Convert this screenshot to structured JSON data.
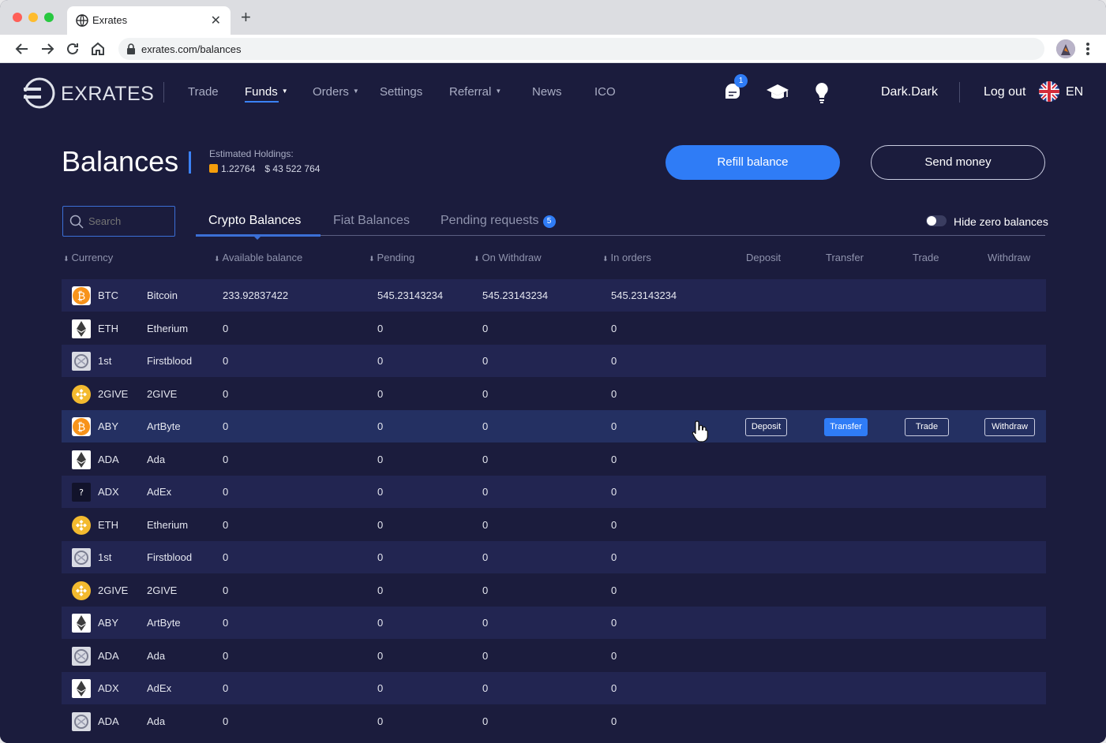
{
  "browser": {
    "tab_title": "Exrates",
    "url": "exrates.com/balances"
  },
  "header": {
    "brand": "EXRATES",
    "menu": [
      {
        "label": "Trade",
        "active": false,
        "dropdown": false
      },
      {
        "label": "Funds",
        "active": true,
        "dropdown": true
      },
      {
        "label": "Orders",
        "active": false,
        "dropdown": true
      },
      {
        "label": "Settings",
        "active": false,
        "dropdown": false
      },
      {
        "label": "Referral",
        "active": false,
        "dropdown": true
      },
      {
        "label": "News",
        "active": false,
        "dropdown": false
      },
      {
        "label": "ICO",
        "active": false,
        "dropdown": false
      }
    ],
    "notification_count": "1",
    "icons": [
      "chat-bell-icon",
      "graduation-cap-icon",
      "lightbulb-icon"
    ],
    "username": "Dark.Dark",
    "logout": "Log out",
    "language": "EN"
  },
  "page": {
    "title": "Balances",
    "estimated_label": "Estimated Holdings:",
    "estimated_btc": "1.22764",
    "estimated_usd": "$ 43 522 764",
    "refill_button": "Refill balance",
    "send_button": "Send money"
  },
  "filters": {
    "search_placeholder": "Search",
    "tabs": [
      {
        "label": "Crypto Balances",
        "active": true
      },
      {
        "label": "Fiat Balances",
        "active": false
      },
      {
        "label": "Pending requests",
        "active": false,
        "count": "5"
      }
    ],
    "hide_zero_label": "Hide zero balances",
    "hide_zero_on": false
  },
  "table": {
    "headers": {
      "currency": "Currency",
      "available": "Available balance",
      "pending": "Pending",
      "on_withdraw": "On Withdraw",
      "in_orders": "In orders",
      "deposit": "Deposit",
      "transfer": "Transfer",
      "trade": "Trade",
      "withdraw": "Withdraw"
    },
    "row_actions": {
      "deposit": "Deposit",
      "transfer": "Transfer",
      "trade": "Trade",
      "withdraw": "Withdraw"
    },
    "rows": [
      {
        "icon": "bitcoin-icon",
        "code": "BTC",
        "name": "Bitcoin",
        "available": "233.92837422",
        "pending": "545.23143234",
        "on_withdraw": "545.23143234",
        "in_orders": "545.23143234"
      },
      {
        "icon": "ethereum-icon",
        "code": "ETH",
        "name": "Etherium",
        "available": "0",
        "pending": "0",
        "on_withdraw": "0",
        "in_orders": "0"
      },
      {
        "icon": "firstblood-icon",
        "code": "1st",
        "name": "Firstblood",
        "available": "0",
        "pending": "0",
        "on_withdraw": "0",
        "in_orders": "0"
      },
      {
        "icon": "binance-coin-icon",
        "code": "2GIVE",
        "name": "2GIVE",
        "available": "0",
        "pending": "0",
        "on_withdraw": "0",
        "in_orders": "0"
      },
      {
        "icon": "bitcoin-icon",
        "code": "ABY",
        "name": "ArtByte",
        "available": "0",
        "pending": "0",
        "on_withdraw": "0",
        "in_orders": "0",
        "hovered": true
      },
      {
        "icon": "ethereum-icon",
        "code": "ADA",
        "name": "Ada",
        "available": "0",
        "pending": "0",
        "on_withdraw": "0",
        "in_orders": "0"
      },
      {
        "icon": "unknown-coin-icon",
        "code": "ADX",
        "name": "AdEx",
        "available": "0",
        "pending": "0",
        "on_withdraw": "0",
        "in_orders": "0"
      },
      {
        "icon": "binance-coin-icon",
        "code": "ETH",
        "name": "Etherium",
        "available": "0",
        "pending": "0",
        "on_withdraw": "0",
        "in_orders": "0"
      },
      {
        "icon": "firstblood-icon",
        "code": "1st",
        "name": "Firstblood",
        "available": "0",
        "pending": "0",
        "on_withdraw": "0",
        "in_orders": "0"
      },
      {
        "icon": "binance-coin-icon",
        "code": "2GIVE",
        "name": "2GIVE",
        "available": "0",
        "pending": "0",
        "on_withdraw": "0",
        "in_orders": "0"
      },
      {
        "icon": "ethereum-icon",
        "code": "ABY",
        "name": "ArtByte",
        "available": "0",
        "pending": "0",
        "on_withdraw": "0",
        "in_orders": "0"
      },
      {
        "icon": "firstblood-icon",
        "code": "ADA",
        "name": "Ada",
        "available": "0",
        "pending": "0",
        "on_withdraw": "0",
        "in_orders": "0"
      },
      {
        "icon": "ethereum-icon",
        "code": "ADX",
        "name": "AdEx",
        "available": "0",
        "pending": "0",
        "on_withdraw": "0",
        "in_orders": "0"
      },
      {
        "icon": "firstblood-icon",
        "code": "ADA",
        "name": "Ada",
        "available": "0",
        "pending": "0",
        "on_withdraw": "0",
        "in_orders": "0"
      }
    ]
  },
  "colors": {
    "background": "#1b1c3d",
    "row_alt": "#222551",
    "row_hover": "#243062",
    "accent": "#2f7cf6"
  }
}
